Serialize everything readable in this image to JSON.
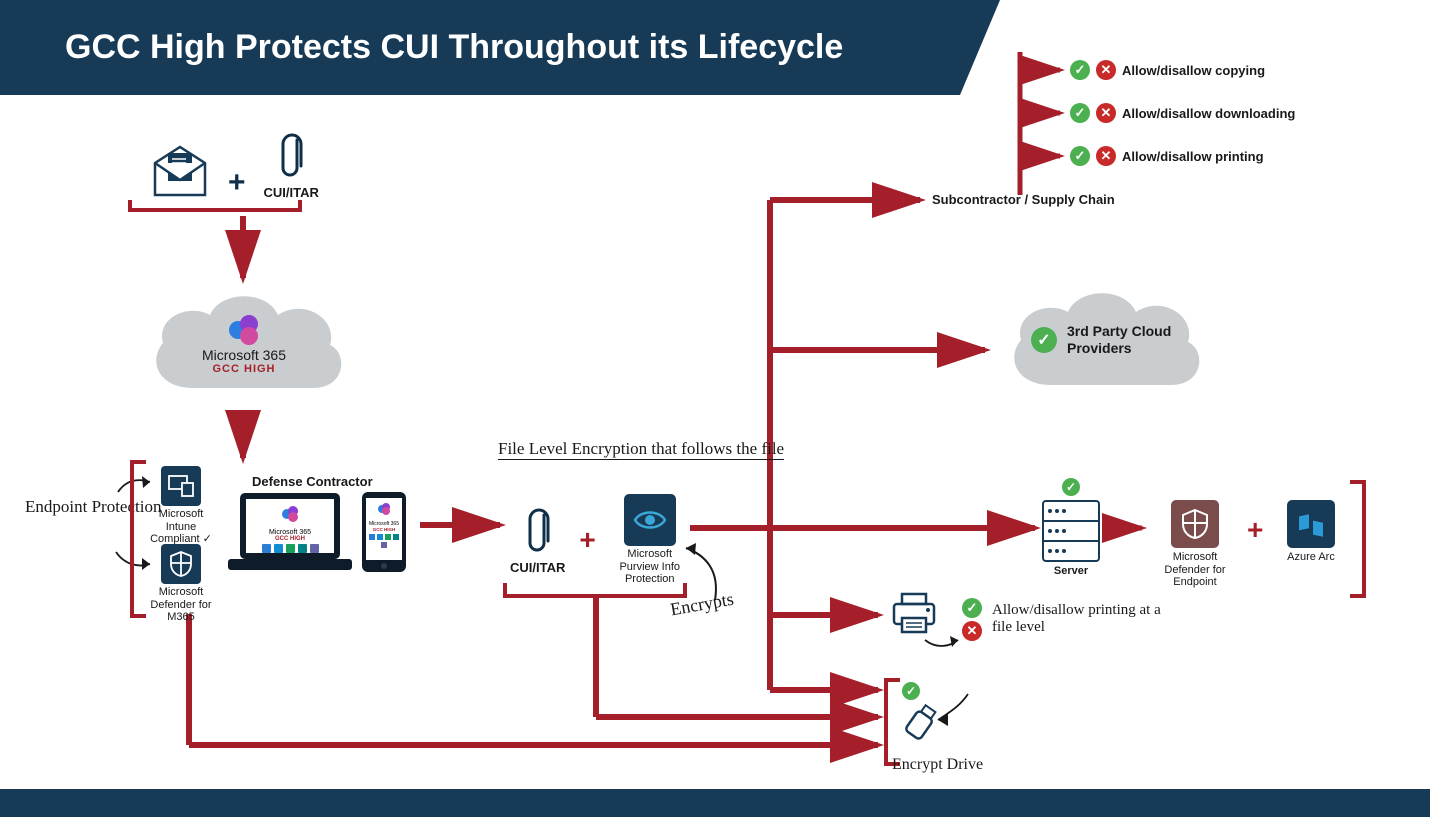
{
  "title": "GCC High Protects CUI Throughout its Lifecycle",
  "email_attach": {
    "label": "CUI/ITAR"
  },
  "cloud_m365": {
    "line1": "Microsoft 365",
    "line2": "GCC HIGH"
  },
  "endpoint_protection": "Endpoint Protection",
  "intune": "Microsoft Intune Compliant ✓",
  "defender_m365": "Microsoft Defender for M365",
  "defense_contractor": "Defense Contractor",
  "file_level_encryption": "File Level Encryption that follows the file",
  "encrypts": "Encrypts",
  "cui_itar2": "CUI/ITAR",
  "purview": "Microsoft Purview Info Protection",
  "subcontractor": "Subcontractor / Supply Chain",
  "allow_copy": "Allow/disallow copying",
  "allow_download": "Allow/disallow downloading",
  "allow_print": "Allow/disallow printing",
  "third_party": "3rd Party Cloud Providers",
  "server": "Server",
  "defender_endpoint": "Microsoft Defender for Endpoint",
  "azure_arc": "Azure Arc",
  "print_file_level": "Allow/disallow printing at a file level",
  "encrypt_drive": "Encrypt Drive",
  "m365_gcc_small": "Microsoft 365",
  "gcc_high_small": "GCC HIGH"
}
